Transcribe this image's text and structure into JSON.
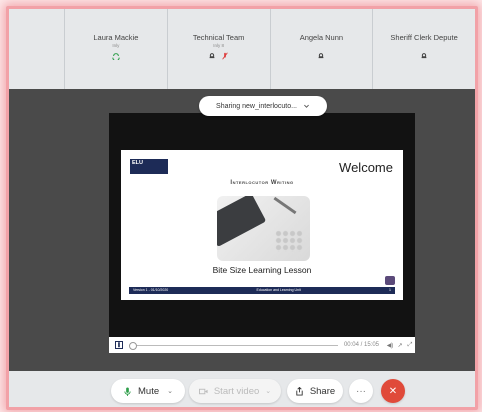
{
  "participants": [
    {
      "name": "Laura Mackie",
      "sub": "Inly"
    },
    {
      "name": "Technical Team",
      "sub": "Inly 8"
    },
    {
      "name": "Angela Nunn",
      "sub": ""
    },
    {
      "name": "Sheriff Clerk Depute",
      "sub": ""
    }
  ],
  "share_pill": {
    "label": "Sharing new_interlocuto..."
  },
  "slide": {
    "logo": "ELU",
    "heading": "Welcome",
    "subtitle": "Interlocutor Writing",
    "lesson": "Bite Size Learning Lesson",
    "footer_left": "Version 1 - 01/10/2020",
    "footer_center": "Education and Learning Unit",
    "footer_right": "1"
  },
  "player": {
    "time": "00:04 / 15:05"
  },
  "toolbar": {
    "mute_label": "Mute",
    "video_label": "Start video",
    "share_label": "Share",
    "more_label": "···"
  },
  "colors": {
    "accent_red": "#e04a3a",
    "slide_navy": "#1d2b57",
    "frame_highlight": "#f2a1a7"
  }
}
